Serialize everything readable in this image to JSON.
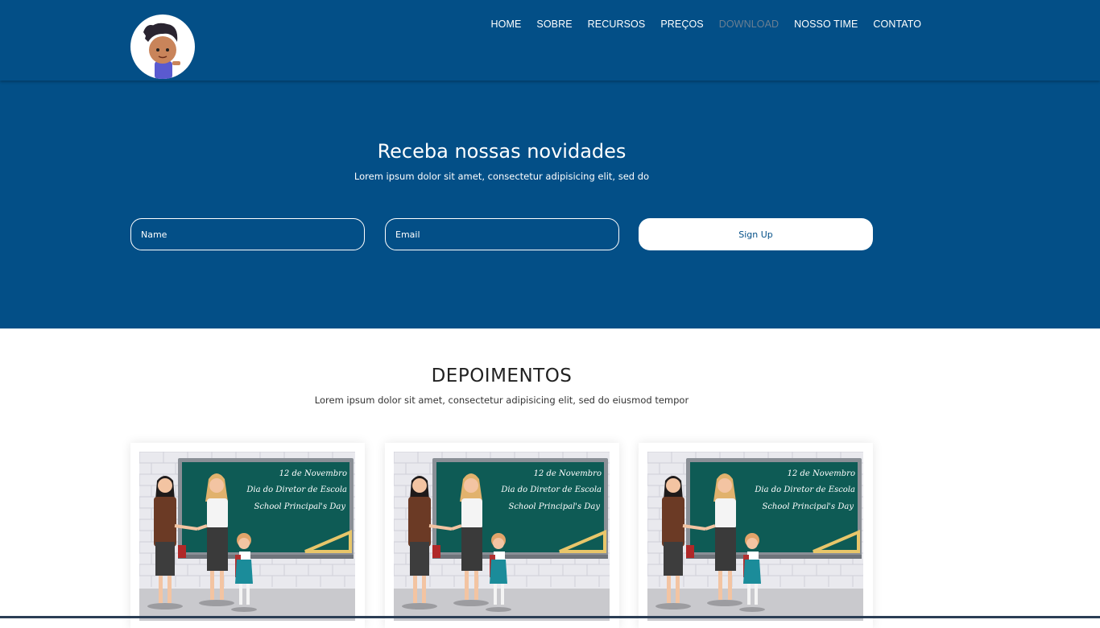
{
  "nav": {
    "items": [
      "HOME",
      "SOBRE",
      "RECURSOS",
      "PREÇOS",
      "DOWNLOAD",
      "NOSSO TIME",
      "CONTATO"
    ],
    "active": "DOWNLOAD"
  },
  "newsletter": {
    "title": "Receba nossas novidades",
    "subtitle": "Lorem ipsum dolor sit amet, consectetur adipisicing elit, sed do",
    "name_placeholder": "Name",
    "email_placeholder": "Email",
    "button_label": "Sign Up"
  },
  "testimonials": {
    "title": "DEPOIMENTOS",
    "subtitle": "Lorem ipsum dolor sit amet, consectetur adipisicing elit, sed do eiusmod tempor",
    "card_board_lines": [
      "12 de Novembro",
      "Dia do Diretor de Escola",
      "School Principal's Day"
    ]
  },
  "colors": {
    "header_bg": "#034f87",
    "accent": "#ffffff",
    "board": "#0e5b55"
  }
}
